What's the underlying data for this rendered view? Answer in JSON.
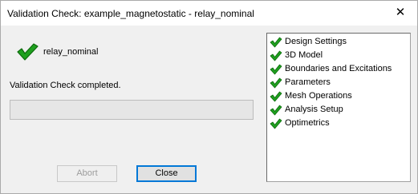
{
  "window": {
    "title": "Validation Check: example_magnetostatic - relay_nominal",
    "close_glyph": "✕"
  },
  "project": {
    "name": "relay_nominal",
    "icon": "green-check-icon",
    "icon_color": "#1fa01f"
  },
  "status": {
    "message": "Validation Check completed.",
    "progress": 0
  },
  "buttons": {
    "abort": "Abort",
    "close": "Close"
  },
  "checks": [
    {
      "label": "Design Settings",
      "status": "pass"
    },
    {
      "label": "3D Model",
      "status": "pass"
    },
    {
      "label": "Boundaries and Excitations",
      "status": "pass"
    },
    {
      "label": "Parameters",
      "status": "pass"
    },
    {
      "label": "Mesh Operations",
      "status": "pass"
    },
    {
      "label": "Analysis Setup",
      "status": "pass"
    },
    {
      "label": "Optimetrics",
      "status": "pass"
    }
  ]
}
